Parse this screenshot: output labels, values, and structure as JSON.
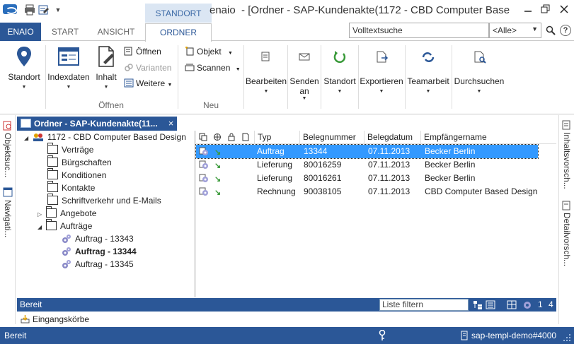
{
  "window": {
    "app_name": "enaio",
    "title": "[Ordner - SAP-Kundenakte(1172 - CBD Computer Base",
    "context_tab_header": "STANDORT"
  },
  "tabs": [
    {
      "label": "ENAIO"
    },
    {
      "label": "START"
    },
    {
      "label": "ANSICHT"
    },
    {
      "label": "ORDNER"
    }
  ],
  "search": {
    "placeholder": "Volltextsuche",
    "scope": "<Alle>",
    "help": "?"
  },
  "ribbon": {
    "standort_left": "Standort",
    "indexdaten": "Indexdaten",
    "inhalt": "Inhalt",
    "oeffnen": "Öffnen",
    "varianten": "Varianten",
    "weitere": "Weitere",
    "group_oeffnen": "Öffnen",
    "objekt": "Objekt",
    "scannen": "Scannen",
    "group_neu": "Neu",
    "bearbeiten": "Bearbeiten",
    "senden_1": "Senden",
    "senden_2": "an",
    "standort": "Standort",
    "exportieren": "Exportieren",
    "teamarbeit": "Teamarbeit",
    "durchsuchen": "Durchsuchen"
  },
  "side_tabs": {
    "left": [
      "Objektsuc...",
      "Navigati..."
    ],
    "right": [
      "Inhaltsvorsch...",
      "Detailvorsch..."
    ]
  },
  "panel": {
    "title": "Ordner - SAP-Kundenakte(11...",
    "close": "×"
  },
  "tree": {
    "root": "1172 - CBD Computer Based Design",
    "items": [
      {
        "label": "Verträge"
      },
      {
        "label": "Bürgschaften"
      },
      {
        "label": "Konditionen"
      },
      {
        "label": "Kontakte"
      },
      {
        "label": "Schriftverkehr und E-Mails"
      },
      {
        "label": "Angebote"
      },
      {
        "label": "Aufträge"
      }
    ],
    "documents": [
      {
        "label": "Auftrag - 13343"
      },
      {
        "label": "Auftrag - 13344"
      },
      {
        "label": "Auftrag - 13345"
      }
    ]
  },
  "list": {
    "columns": [
      "Typ",
      "Belegnummer",
      "Belegdatum",
      "Empfängername"
    ],
    "rows": [
      {
        "typ": "Auftrag",
        "belegnummer": "13344",
        "belegdatum": "07.11.2013",
        "empfaenger": "Becker Berlin"
      },
      {
        "typ": "Lieferung",
        "belegnummer": "80016259",
        "belegdatum": "07.11.2013",
        "empfaenger": "Becker Berlin"
      },
      {
        "typ": "Lieferung",
        "belegnummer": "80016261",
        "belegdatum": "07.11.2013",
        "empfaenger": "Becker Berlin"
      },
      {
        "typ": "Rechnung",
        "belegnummer": "90038105",
        "belegdatum": "07.11.2013",
        "empfaenger": "CBD Computer Based Design"
      }
    ]
  },
  "panel_status": {
    "text": "Bereit",
    "filter_placeholder": "Liste filtern",
    "count_a": "1",
    "count_b": "4"
  },
  "inbox": {
    "label": "Eingangskörbe"
  },
  "statusbar": {
    "text": "Bereit",
    "server": "sap-templ-demo#4000"
  },
  "colors": {
    "accent": "#2b5797",
    "selection": "#3399ff"
  }
}
